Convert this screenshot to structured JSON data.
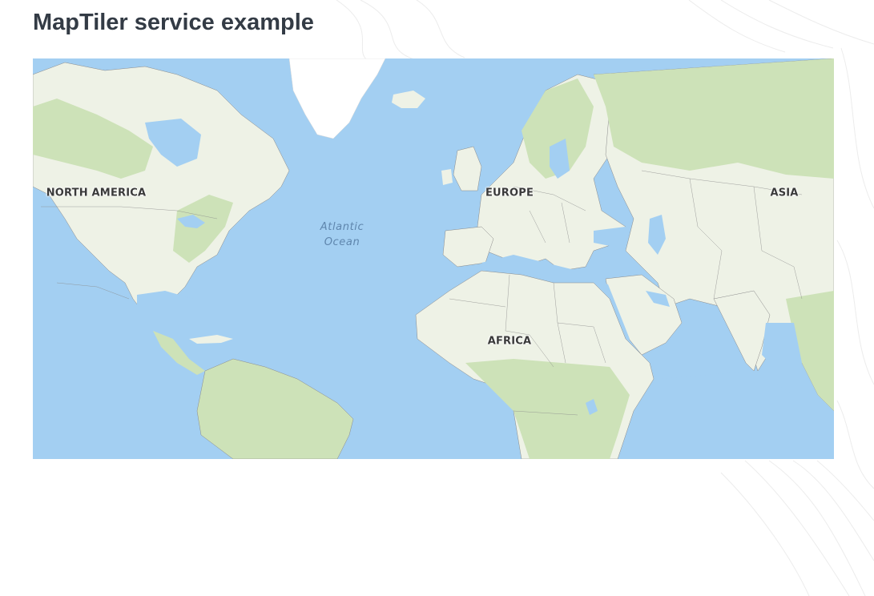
{
  "page": {
    "title": "MapTiler service example"
  },
  "map": {
    "labels": {
      "north_america": "NORTH AMERICA",
      "europe": "EUROPE",
      "asia": "ASIA",
      "africa": "AFRICA"
    },
    "ocean": {
      "line1": "Atlantic",
      "line2": "Ocean"
    },
    "colors": {
      "water": "#a3cff2",
      "land": "#eef2e6",
      "forest": "#cde2b8",
      "ice": "#ffffff",
      "border": "#8a8a8a"
    }
  }
}
